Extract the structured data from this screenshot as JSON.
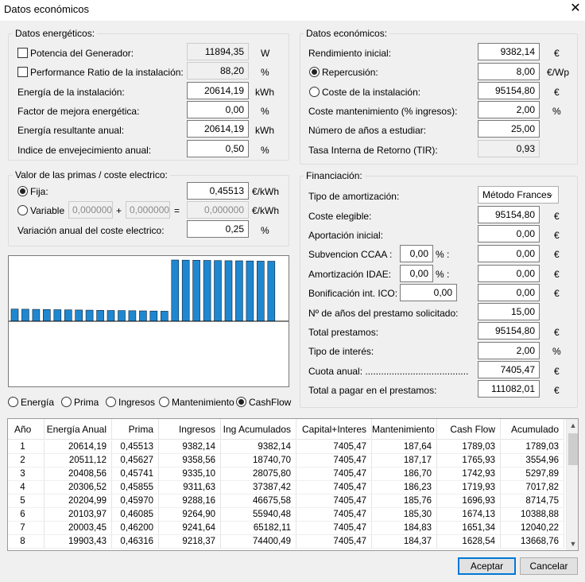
{
  "window": {
    "title": "Datos económicos",
    "close": "✕"
  },
  "energy": {
    "title": "Datos energéticos:",
    "rows": [
      {
        "label": "Potencia del Generador:",
        "value": "11894,35",
        "unit": "W"
      },
      {
        "label": "Performance Ratio de la instalación:",
        "value": "88,20",
        "unit": "%"
      },
      {
        "label": "Energía de la instalación:",
        "value": "20614,19",
        "unit": "kWh"
      },
      {
        "label": "Factor de mejora energética:",
        "value": "0,00",
        "unit": "%"
      },
      {
        "label": "Energía resultante anual:",
        "value": "20614,19",
        "unit": "kWh"
      },
      {
        "label": "Indice de envejecimiento anual:",
        "value": "0,50",
        "unit": "%"
      }
    ]
  },
  "primas": {
    "title": "Valor de las primas / coste electrico:",
    "fija_label": "Fija:",
    "fija_value": "0,45513",
    "unit": "€/kWh",
    "variable_label": "Variable",
    "variable_a": "0,000000",
    "plus": "+",
    "variable_b": "0,000000",
    "equals": "=",
    "variable_result": "0,000000",
    "variacion_label": "Variación anual del coste electrico:",
    "variacion_value": "0,25",
    "variacion_unit": "%"
  },
  "econ": {
    "title": "Datos económicos:",
    "rows": [
      {
        "label": "Rendimiento inicial:",
        "value": "9382,14",
        "unit": "€"
      },
      {
        "label": "Repercusión:",
        "value": "8,00",
        "unit": "€/Wp"
      },
      {
        "label": "Coste de la instalación:",
        "value": "95154,80",
        "unit": "€"
      },
      {
        "label": "Coste mantenimiento (% ingresos):",
        "value": "2,00",
        "unit": "%"
      },
      {
        "label": "Número de años a estudiar:",
        "value": "25,00",
        "unit": ""
      },
      {
        "label": "Tasa Interna de Retorno (TIR):",
        "value": "0,93",
        "unit": ""
      }
    ]
  },
  "fin": {
    "title": "Financiación:",
    "tipo_label": "Tipo de amortización:",
    "tipo_value": "Método Frances",
    "coste_label": "Coste elegible:",
    "coste_value": "95154,80",
    "coste_unit": "€",
    "aport_label": "Aportación inicial:",
    "aport_value": "0,00",
    "aport_unit": "€",
    "subv_label": "Subvencion CCAA :",
    "subv_pct": "0,00",
    "subv_pct_unit": "% :",
    "subv_value": "0,00",
    "subv_unit": "€",
    "amort_label": "Amortización IDAE:",
    "amort_pct": "0,00",
    "amort_pct_unit": "% :",
    "amort_value": "0,00",
    "amort_unit": "€",
    "bonif_label": "Bonificación int. ICO:",
    "bonif_pct": "0,00",
    "bonif_value": "0,00",
    "bonif_unit": "€",
    "anos_label": "Nº de años del prestamo solicitado:",
    "anos_value": "15,00",
    "total_label": "Total prestamos:",
    "total_value": "95154,80",
    "total_unit": "€",
    "interes_label": "Tipo de interés:",
    "interes_value": "2,00",
    "interes_unit": "%",
    "cuota_label": "Cuota anual: ..........................................",
    "cuota_value": "7405,47",
    "cuota_unit": "€",
    "pagar_label": "Total a pagar en el prestamos:",
    "pagar_value": "111082,01",
    "pagar_unit": "€"
  },
  "chart_options": [
    "Energía",
    "Prima",
    "Ingresos",
    "Mantenimiento",
    "CashFlow"
  ],
  "chart_selected": "CashFlow",
  "chart_data": {
    "type": "bar",
    "values": [
      1789.03,
      1765.93,
      1742.93,
      1719.93,
      1696.93,
      1674.13,
      1651.34,
      1628.54,
      1605.8,
      1583.1,
      1560.4,
      1537.7,
      1515.0,
      1492.3,
      1469.6,
      9000,
      8980,
      8960,
      8940,
      8920,
      8900,
      8880,
      8860,
      8840,
      8820
    ],
    "color": "#1f87d0"
  },
  "table": {
    "columns": [
      "Año",
      "Energía Anual",
      "Prima",
      "Ingresos",
      "Ing Acumulados",
      "Capital+Interes",
      "Mantenimiento",
      "Cash Flow",
      "Acumulado"
    ],
    "rows": [
      [
        "1",
        "20614,19",
        "0,45513",
        "9382,14",
        "9382,14",
        "7405,47",
        "187,64",
        "1789,03",
        "1789,03"
      ],
      [
        "2",
        "20511,12",
        "0,45627",
        "9358,56",
        "18740,70",
        "7405,47",
        "187,17",
        "1765,93",
        "3554,96"
      ],
      [
        "3",
        "20408,56",
        "0,45741",
        "9335,10",
        "28075,80",
        "7405,47",
        "186,70",
        "1742,93",
        "5297,89"
      ],
      [
        "4",
        "20306,52",
        "0,45855",
        "9311,63",
        "37387,42",
        "7405,47",
        "186,23",
        "1719,93",
        "7017,82"
      ],
      [
        "5",
        "20204,99",
        "0,45970",
        "9288,16",
        "46675,58",
        "7405,47",
        "185,76",
        "1696,93",
        "8714,75"
      ],
      [
        "6",
        "20103,97",
        "0,46085",
        "9264,90",
        "55940,48",
        "7405,47",
        "185,30",
        "1674,13",
        "10388,88"
      ],
      [
        "7",
        "20003,45",
        "0,46200",
        "9241,64",
        "65182,11",
        "7405,47",
        "184,83",
        "1651,34",
        "12040,22"
      ],
      [
        "8",
        "19903,43",
        "0,46316",
        "9218,37",
        "74400,49",
        "7405,47",
        "184,37",
        "1628,54",
        "13668,76"
      ]
    ]
  },
  "buttons": {
    "ok": "Aceptar",
    "cancel": "Cancelar"
  }
}
